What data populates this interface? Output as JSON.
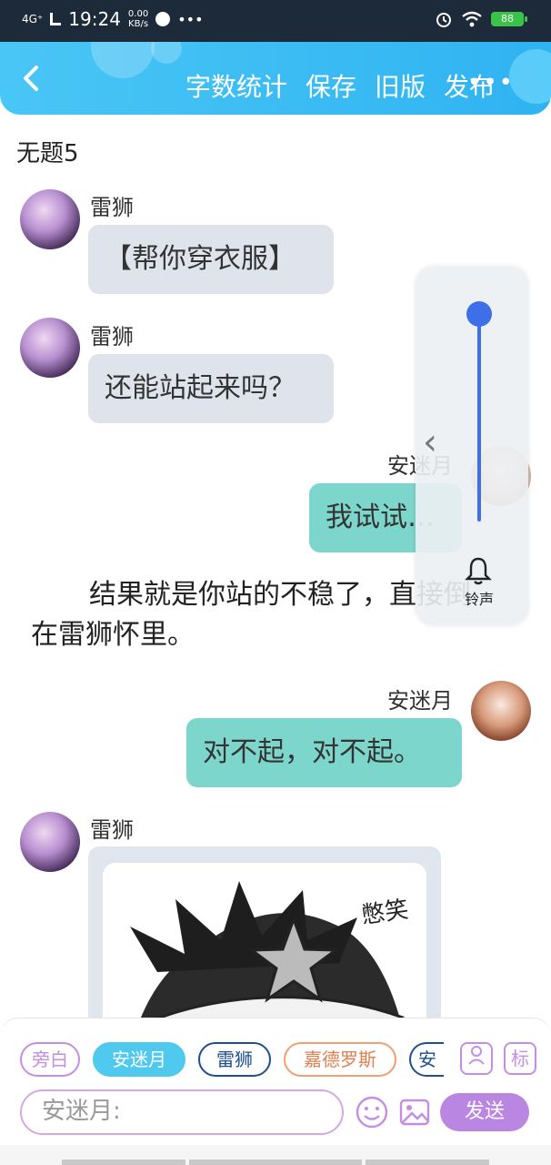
{
  "status_bar": {
    "network": "4G⁺",
    "time": "19:24",
    "speed_value": "0.00",
    "speed_unit": "KB/s",
    "battery": "88"
  },
  "header": {
    "menu": [
      "字数统计",
      "保存",
      "旧版",
      "发布"
    ]
  },
  "page": {
    "title": "无题5"
  },
  "messages": [
    {
      "speaker": "雷狮",
      "text": "【帮你穿衣服】"
    },
    {
      "speaker": "雷狮",
      "text": "还能站起来吗？"
    },
    {
      "speaker": "安迷月",
      "text": "我试试…"
    },
    {
      "speaker": "安迷月",
      "text": "对不起，对不起。"
    },
    {
      "speaker": "雷狮",
      "text": ""
    }
  ],
  "narration": {
    "line1": "结果就是你站的不稳了，直接倒",
    "line2": "在雷狮怀里。"
  },
  "image_card": {
    "caption": "憋笑"
  },
  "volume_panel": {
    "level": 0.95,
    "label": "铃声"
  },
  "characters": [
    {
      "label": "旁白",
      "color": "#c58de6"
    },
    {
      "label": "安迷月",
      "color": "#4fc9ee"
    },
    {
      "label": "雷狮",
      "color": "#1f4f8f"
    },
    {
      "label": "嘉德罗斯",
      "color": "#f0a070"
    },
    {
      "label": "安",
      "color": "#1f4f8f"
    }
  ],
  "tools": {
    "profile_label": "",
    "tag_label": "标"
  },
  "composer": {
    "placeholder": "安迷月:",
    "send_label": "发送"
  }
}
